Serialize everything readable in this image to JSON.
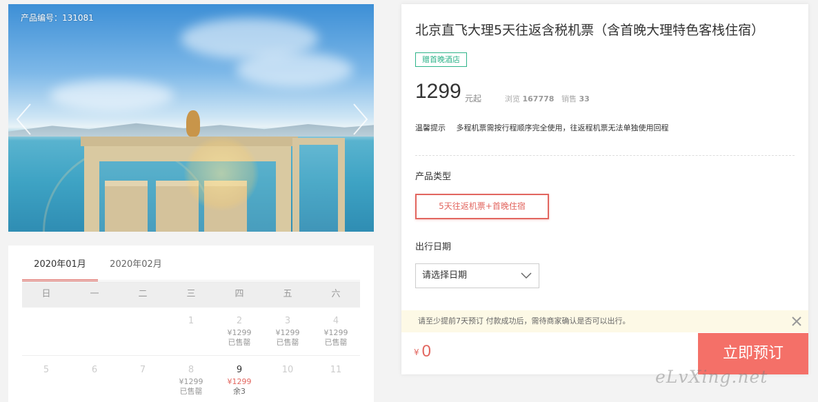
{
  "hero": {
    "product_code": "产品编号：131081"
  },
  "calendar": {
    "tabs": [
      "2020年01月",
      "2020年02月"
    ],
    "weekdays": [
      "日",
      "一",
      "二",
      "三",
      "四",
      "五",
      "六"
    ],
    "weeks": [
      [
        {
          "num": "",
          "price": "",
          "status": ""
        },
        {
          "num": "",
          "price": "",
          "status": ""
        },
        {
          "num": "",
          "price": "",
          "status": ""
        },
        {
          "num": "1",
          "price": "",
          "status": ""
        },
        {
          "num": "2",
          "price": "¥1299",
          "status": "已售罄"
        },
        {
          "num": "3",
          "price": "¥1299",
          "status": "已售罄"
        },
        {
          "num": "4",
          "price": "¥1299",
          "status": "已售罄"
        }
      ],
      [
        {
          "num": "5",
          "price": "",
          "status": ""
        },
        {
          "num": "6",
          "price": "",
          "status": ""
        },
        {
          "num": "7",
          "price": "",
          "status": ""
        },
        {
          "num": "8",
          "price": "¥1299",
          "status": "已售罄"
        },
        {
          "num": "9",
          "price": "¥1299",
          "status": "余3"
        },
        {
          "num": "10",
          "price": "",
          "status": ""
        },
        {
          "num": "11",
          "price": "",
          "status": ""
        }
      ]
    ]
  },
  "product": {
    "title": "北京直飞大理5天往返含税机票（含首晚大理特色客栈住宿）",
    "tag": "赠首晚酒店",
    "price": "1299",
    "price_unit": "元起",
    "views_label": "浏览",
    "views_value": "167778",
    "sales_label": "销售",
    "sales_value": "33",
    "tip_label": "温馨提示",
    "tip_text": "多程机票需按行程顺序完全使用，往返程机票无法单独使用回程",
    "type_label": "产品类型",
    "type_option": "5天往返机票+首晚住宿",
    "date_label": "出行日期",
    "date_placeholder": "请选择日期",
    "notice": "请至少提前7天预订 付款成功后，需待商家确认是否可以出行。",
    "total_currency": "¥",
    "total_amount": "0",
    "book_label": "立即预订"
  },
  "watermark": "eLvXing.net",
  "colors": {
    "accent": "#e2665f",
    "book_button": "#f47068",
    "tag_green": "#2db389",
    "notice_bg": "#fdf9e6"
  }
}
